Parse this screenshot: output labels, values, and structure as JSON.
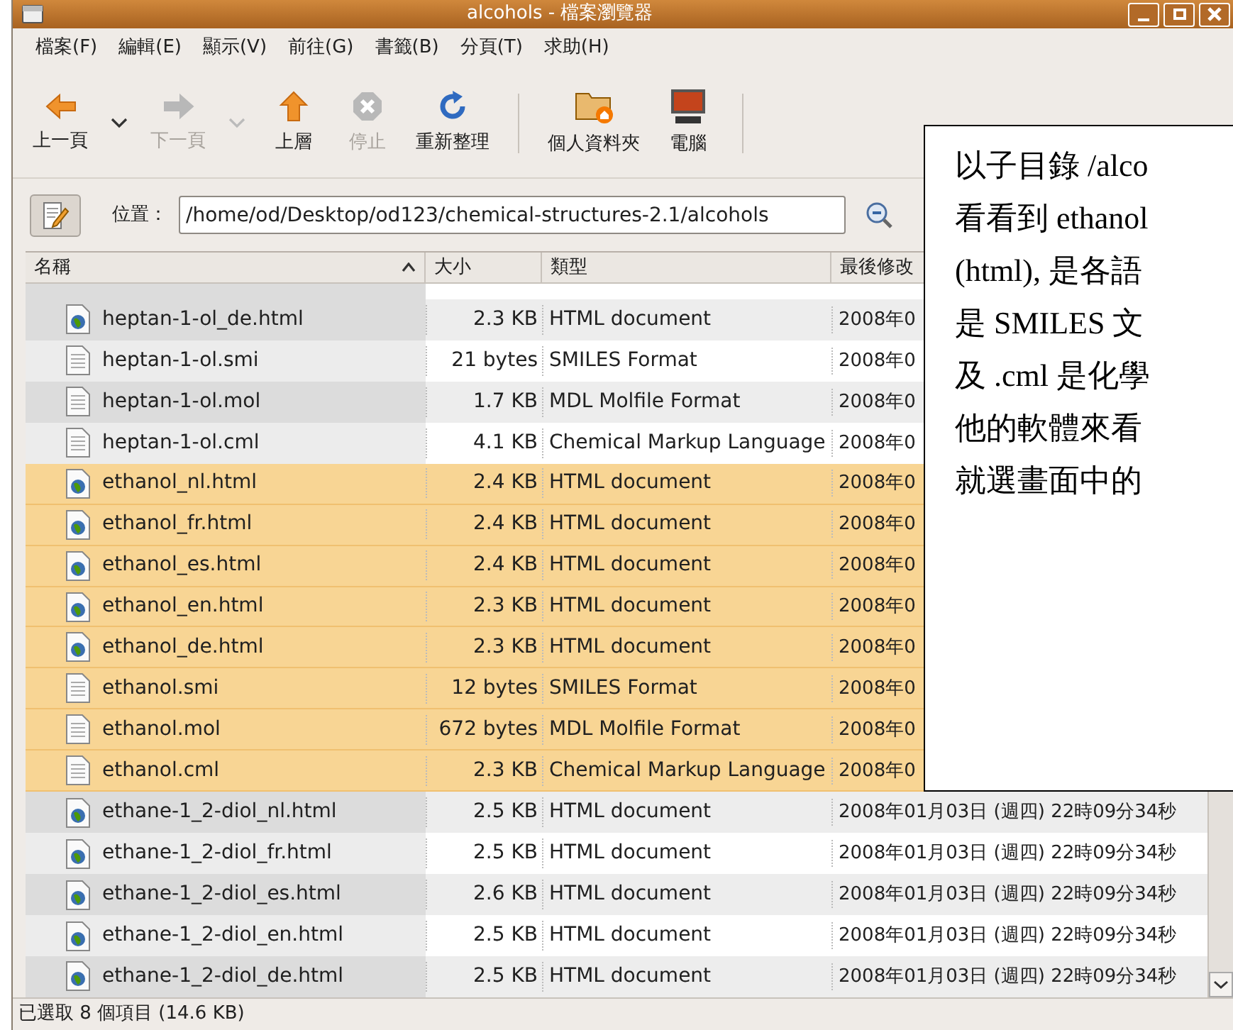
{
  "window": {
    "title": "alcohols - 檔案瀏覽器"
  },
  "menu": [
    "檔案(F)",
    "編輯(E)",
    "顯示(V)",
    "前往(G)",
    "書籤(B)",
    "分頁(T)",
    "求助(H)"
  ],
  "toolbar": [
    {
      "kind": "back",
      "label": "上一頁",
      "disabled": false,
      "dropdown": true
    },
    {
      "kind": "forward",
      "label": "下一頁",
      "disabled": true,
      "dropdown": true
    },
    {
      "kind": "up",
      "label": "上層",
      "disabled": false,
      "dropdown": false
    },
    {
      "kind": "stop",
      "label": "停止",
      "disabled": true,
      "dropdown": false
    },
    {
      "kind": "reload",
      "label": "重新整理",
      "disabled": false,
      "dropdown": false
    },
    {
      "kind": "separator"
    },
    {
      "kind": "home",
      "label": "個人資料夾",
      "disabled": false,
      "dropdown": false
    },
    {
      "kind": "computer",
      "label": "電腦",
      "disabled": false,
      "dropdown": false
    },
    {
      "kind": "separator"
    }
  ],
  "location": {
    "label": "位置：",
    "value": "/home/od/Desktop/od123/chemical-structures-2.1/alcohols"
  },
  "table": {
    "columns": [
      "名稱",
      "大小",
      "類型",
      "最後修改"
    ],
    "rows": [
      {
        "name": "heptan-1-ol_de.html",
        "size": "2.3 KB",
        "type": "HTML document",
        "date": "2008年0",
        "kind": "web",
        "selected": false
      },
      {
        "name": "heptan-1-ol.smi",
        "size": "21 bytes",
        "type": "SMILES Format",
        "date": "2008年0",
        "kind": "text",
        "selected": false
      },
      {
        "name": "heptan-1-ol.mol",
        "size": "1.7 KB",
        "type": "MDL Molfile Format",
        "date": "2008年0",
        "kind": "text",
        "selected": false
      },
      {
        "name": "heptan-1-ol.cml",
        "size": "4.1 KB",
        "type": "Chemical Markup Language",
        "date": "2008年0",
        "kind": "text",
        "selected": false
      },
      {
        "name": "ethanol_nl.html",
        "size": "2.4 KB",
        "type": "HTML document",
        "date": "2008年0",
        "kind": "web",
        "selected": true
      },
      {
        "name": "ethanol_fr.html",
        "size": "2.4 KB",
        "type": "HTML document",
        "date": "2008年0",
        "kind": "web",
        "selected": true
      },
      {
        "name": "ethanol_es.html",
        "size": "2.4 KB",
        "type": "HTML document",
        "date": "2008年0",
        "kind": "web",
        "selected": true
      },
      {
        "name": "ethanol_en.html",
        "size": "2.3 KB",
        "type": "HTML document",
        "date": "2008年0",
        "kind": "web",
        "selected": true
      },
      {
        "name": "ethanol_de.html",
        "size": "2.3 KB",
        "type": "HTML document",
        "date": "2008年0",
        "kind": "web",
        "selected": true
      },
      {
        "name": "ethanol.smi",
        "size": "12 bytes",
        "type": "SMILES Format",
        "date": "2008年0",
        "kind": "text",
        "selected": true
      },
      {
        "name": "ethanol.mol",
        "size": "672 bytes",
        "type": "MDL Molfile Format",
        "date": "2008年0",
        "kind": "text",
        "selected": true
      },
      {
        "name": "ethanol.cml",
        "size": "2.3 KB",
        "type": "Chemical Markup Language",
        "date": "2008年0",
        "kind": "text",
        "selected": true
      },
      {
        "name": "ethane-1_2-diol_nl.html",
        "size": "2.5 KB",
        "type": "HTML document",
        "date": "2008年01月03日 (週四) 22時09分34秒",
        "kind": "web",
        "selected": false
      },
      {
        "name": "ethane-1_2-diol_fr.html",
        "size": "2.5 KB",
        "type": "HTML document",
        "date": "2008年01月03日 (週四) 22時09分34秒",
        "kind": "web",
        "selected": false
      },
      {
        "name": "ethane-1_2-diol_es.html",
        "size": "2.6 KB",
        "type": "HTML document",
        "date": "2008年01月03日 (週四) 22時09分34秒",
        "kind": "web",
        "selected": false
      },
      {
        "name": "ethane-1_2-diol_en.html",
        "size": "2.5 KB",
        "type": "HTML document",
        "date": "2008年01月03日 (週四) 22時09分34秒",
        "kind": "web",
        "selected": false
      },
      {
        "name": "ethane-1_2-diol_de.html",
        "size": "2.5 KB",
        "type": "HTML document",
        "date": "2008年01月03日 (週四) 22時09分34秒",
        "kind": "web",
        "selected": false
      }
    ]
  },
  "status_bar": "已選取 8 個項目 (14.6 KB)",
  "callout": {
    "lines": [
      "以子目錄 /alco",
      "看看到 ethanol",
      "(html), 是各語",
      "是 SMILES 文",
      "及 .cml 是化學",
      "他的軟體來看",
      "就選畫面中的"
    ]
  }
}
